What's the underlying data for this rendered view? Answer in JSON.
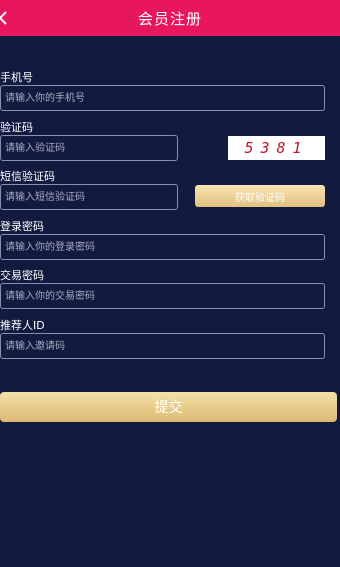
{
  "header": {
    "title": "会员注册",
    "back_icon": "chevron-left-icon"
  },
  "form": {
    "phone": {
      "label": "手机号",
      "placeholder": "请输入你的手机号"
    },
    "verify_code": {
      "label": "验证码",
      "placeholder": "请输入验证码",
      "captcha_text": "5381"
    },
    "sms_code": {
      "label": "短信验证码",
      "placeholder": "请输入短信验证码",
      "button_label": "获取验证码"
    },
    "login_password": {
      "label": "登录密码",
      "placeholder": "请输入你的登录密码"
    },
    "trade_password": {
      "label": "交易密码",
      "placeholder": "请输入你的交易密码"
    },
    "referrer": {
      "label": "推荐人ID",
      "placeholder": "请输入邀请码"
    },
    "submit_label": "提交"
  },
  "colors": {
    "background": "#121a3f",
    "header": "#e8175d",
    "gold_button": "#e2c180",
    "captcha_text": "#c01a2a"
  }
}
